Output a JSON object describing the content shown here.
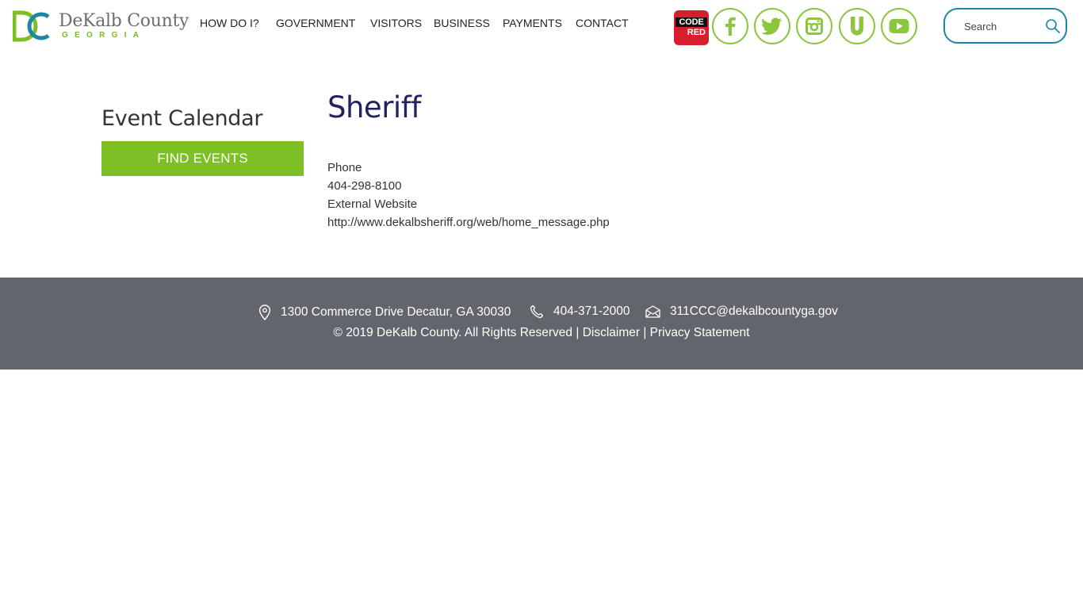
{
  "brand": {
    "name": "DeKalb County",
    "subtitle": "GEORGIA",
    "logo_letters": "DC",
    "colors": {
      "green": "#7dbf24",
      "teal": "#1b87a5",
      "navy": "#22235e",
      "footer": "#62656b",
      "codered": "#d61f2c"
    }
  },
  "nav": {
    "items": [
      {
        "label": "HOW DO I?"
      },
      {
        "label": "GOVERNMENT"
      },
      {
        "label": "VISITORS"
      },
      {
        "label": "BUSINESS"
      },
      {
        "label": "PAYMENTS"
      },
      {
        "label": "CONTACT"
      }
    ]
  },
  "codered": {
    "top": "CODE",
    "bottom": "RED"
  },
  "social": [
    "facebook-icon",
    "twitter-icon",
    "instagram-icon",
    "u-icon",
    "youtube-icon"
  ],
  "search": {
    "placeholder": "Search",
    "value": ""
  },
  "sidebar": {
    "title": "Event Calendar",
    "button": "FIND EVENTS"
  },
  "main": {
    "title": "Sheriff",
    "phone_label": "Phone",
    "phone": "404-298-8100",
    "website_label": "External Website",
    "website": "http://www.dekalbsheriff.org/web/home_message.php"
  },
  "footer": {
    "address": "1300 Commerce Drive Decatur, GA 30030",
    "phone": "404-371-2000",
    "email": "311CCC@dekalbcountyga.gov",
    "copyright": "© 2019 DeKalb County. All Rights Reserved",
    "separator": " | ",
    "disclaimer": "Disclaimer",
    "privacy": "Privacy Statement"
  }
}
